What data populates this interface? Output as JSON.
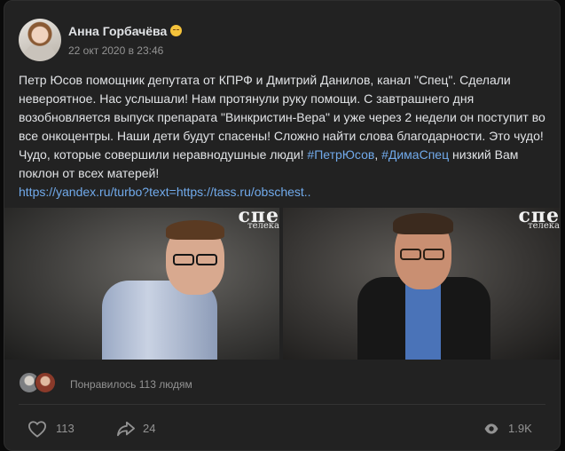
{
  "post": {
    "author": "Анна Горбачёва",
    "author_emoji": "smiling-face-icon",
    "date": "22 окт 2020 в 23:46",
    "text_main": "Петр Юсов помощник депутата от КПРФ и Дмитрий Данилов, канал \"Спец\". Сделали невероятное. Нас услышали! Нам протянули руку помощи. С завтрашнего дня возобновляется выпуск препарата \"Винкристин-Вера\" и уже через 2 недели он поступит во все онкоцентры. Наши дети будут спасены! Сложно найти слова благодарности. Это чудо! Чудо, которые совершили неравнодушные люди!",
    "hashtag_1": "#ПетрЮсов",
    "separator": ", ",
    "hashtag_2": "#ДимаСпец",
    "text_tail": " низкий Вам поклон от всех матерей!",
    "link": "https://yandex.ru/turbo?text=https://tass.ru/obschest.."
  },
  "media": {
    "watermark_left": "спе",
    "watermark_left_sub": "телека",
    "watermark_right": "спе",
    "watermark_right_sub": "телека"
  },
  "reactions": {
    "liked_text": "Понравилось 113 людям"
  },
  "actions": {
    "likes": "113",
    "shares": "24",
    "views": "1.9K"
  },
  "colors": {
    "background": "#0a0a0a",
    "card": "#222222",
    "text": "#e1e3e6",
    "secondary": "#939393",
    "link": "#71aaeb"
  }
}
